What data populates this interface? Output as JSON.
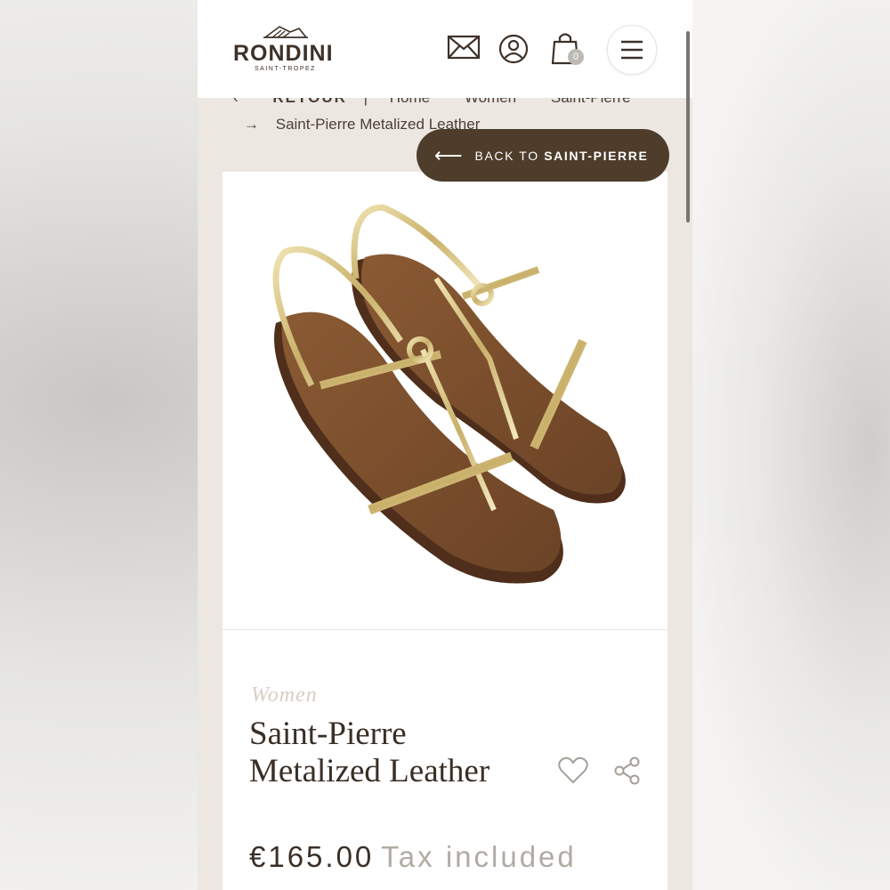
{
  "brand": {
    "name": "RONDINI",
    "tagline": "SAINT-TROPEZ"
  },
  "header": {
    "cart_count": "0"
  },
  "breadcrumb": {
    "retour": "RETOUR",
    "items": [
      "Home",
      "Women",
      "Saint-Pierre"
    ],
    "arrow": "→",
    "current": "Saint-Pierre Metalized Leather"
  },
  "back_button": {
    "arrow": "⟵",
    "prefix": "BACK TO ",
    "target": "SAINT-PIERRE"
  },
  "product": {
    "category": "Women",
    "title": "Saint-Pierre Metalized Leather",
    "price": "€165.00",
    "tax_note": "Tax included"
  },
  "icons": [
    "mail-icon",
    "account-icon",
    "cart-icon",
    "menu-icon",
    "heart-icon",
    "share-icon"
  ],
  "colors": {
    "accent": "#4e3d2b",
    "text": "#3a2f26",
    "page_bg": "#ece7e1"
  }
}
